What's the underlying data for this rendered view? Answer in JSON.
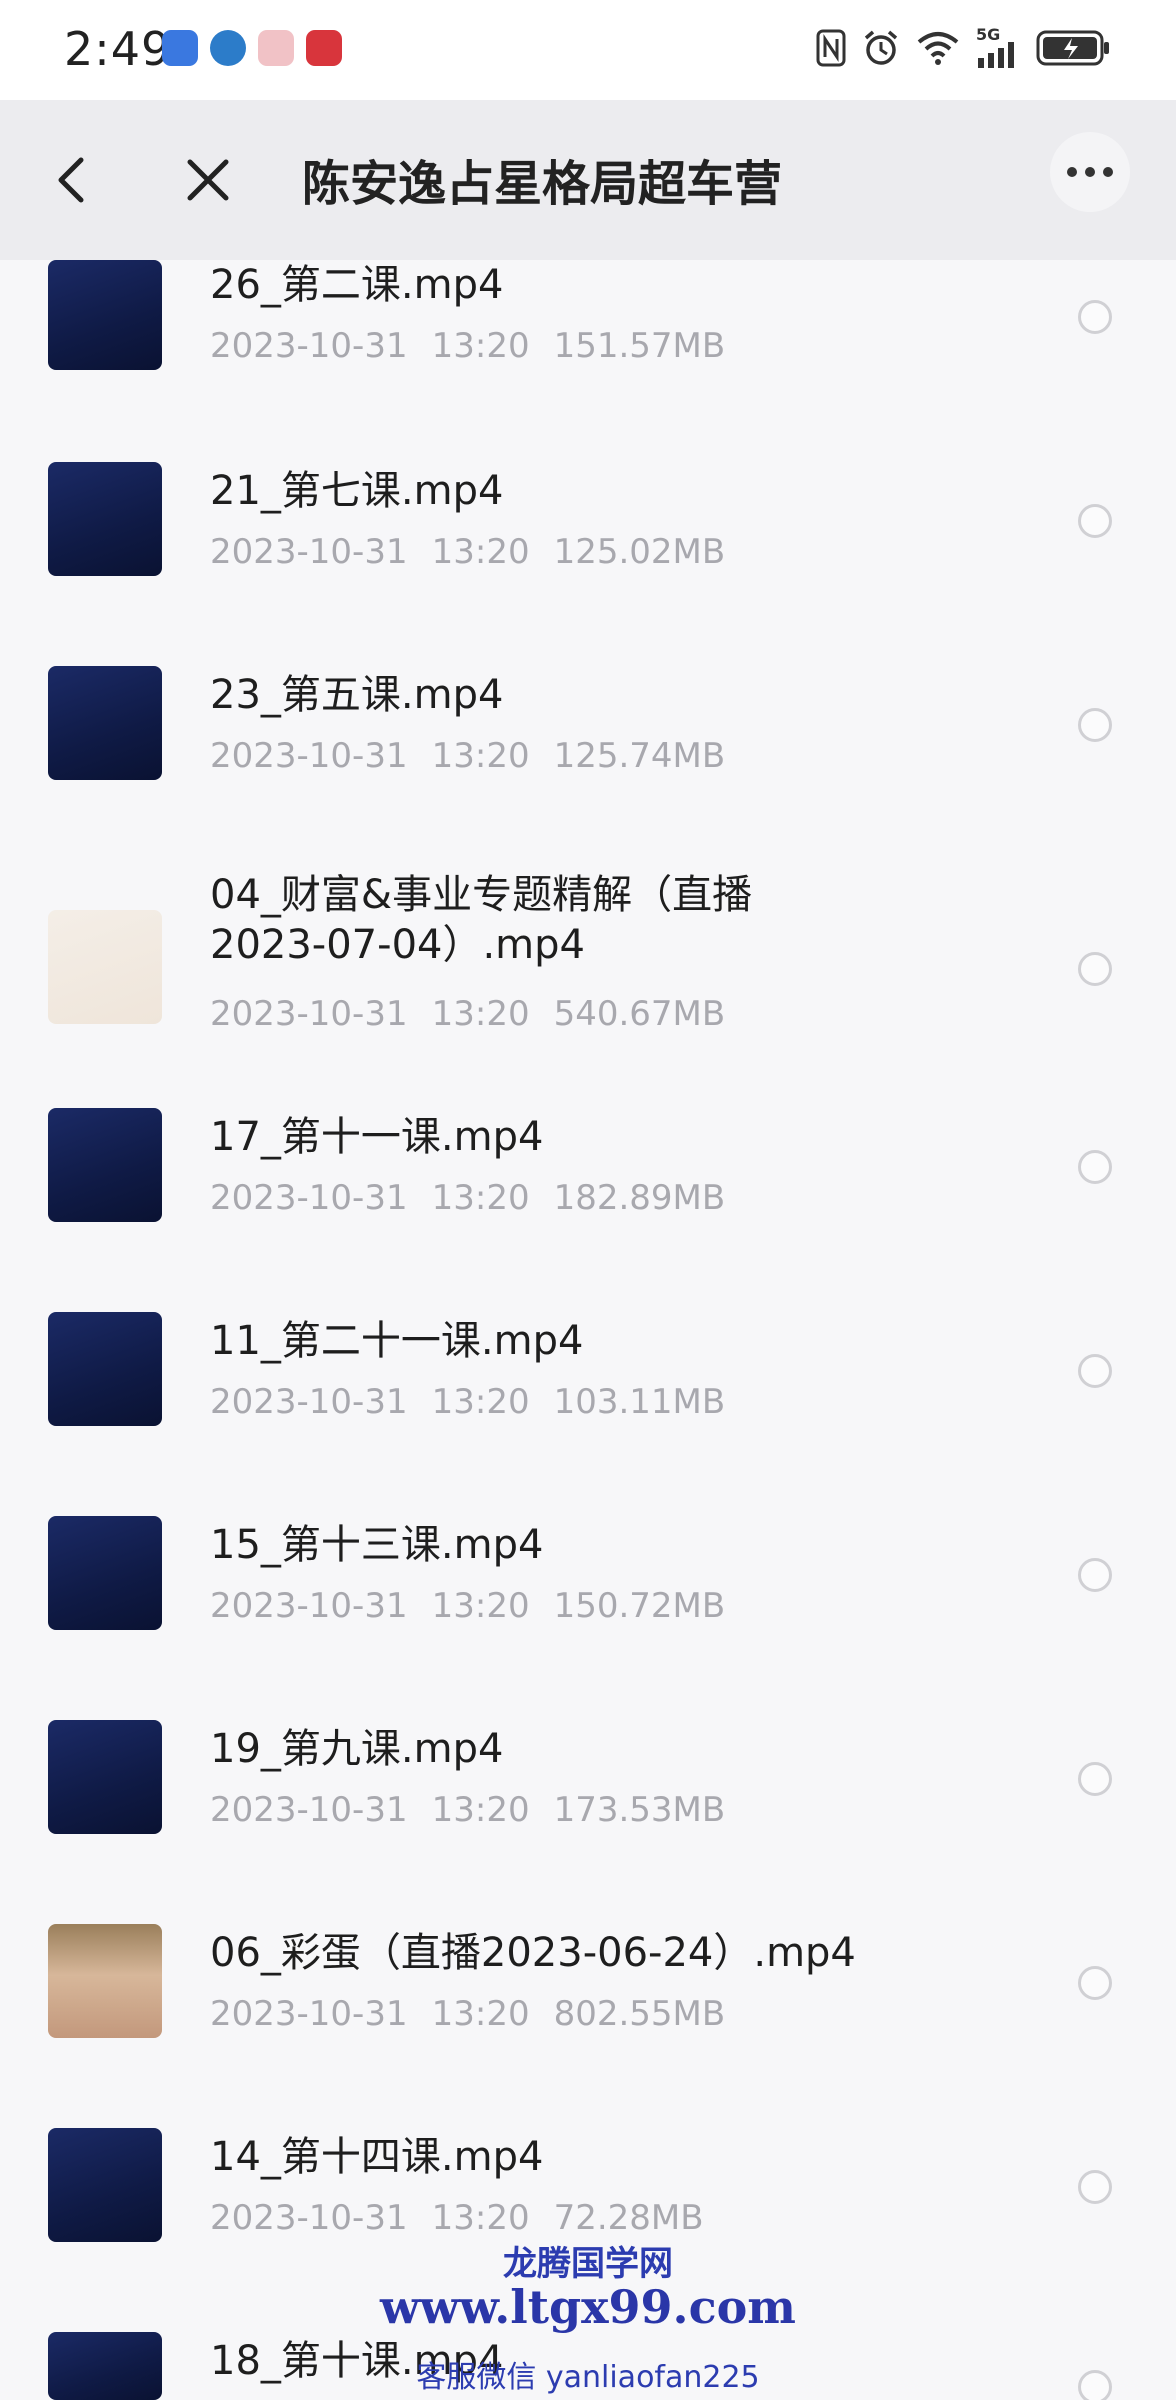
{
  "status_bar": {
    "time": "2:49",
    "network": "5G",
    "app_icon_names": [
      "app-blue-icon",
      "app-weather-icon",
      "app-gift-icon",
      "app-shop-icon"
    ]
  },
  "header": {
    "title": "陈安逸占星格局超车营"
  },
  "files": [
    {
      "name": "26_第二课.mp4",
      "date": "2023-10-31",
      "time": "13:20",
      "size": "151.57MB",
      "thumb": "dark"
    },
    {
      "name": "21_第七课.mp4",
      "date": "2023-10-31",
      "time": "13:20",
      "size": "125.02MB",
      "thumb": "dark"
    },
    {
      "name": "23_第五课.mp4",
      "date": "2023-10-31",
      "time": "13:20",
      "size": "125.74MB",
      "thumb": "dark"
    },
    {
      "name": "04_财富&事业专题精解（直播",
      "name2": "2023-07-04）.mp4",
      "date": "2023-10-31",
      "time": "13:20",
      "size": "540.67MB",
      "thumb": "light"
    },
    {
      "name": "17_第十一课.mp4",
      "date": "2023-10-31",
      "time": "13:20",
      "size": "182.89MB",
      "thumb": "dark"
    },
    {
      "name": "11_第二十一课.mp4",
      "date": "2023-10-31",
      "time": "13:20",
      "size": "103.11MB",
      "thumb": "dark"
    },
    {
      "name": "15_第十三课.mp4",
      "date": "2023-10-31",
      "time": "13:20",
      "size": "150.72MB",
      "thumb": "dark"
    },
    {
      "name": "19_第九课.mp4",
      "date": "2023-10-31",
      "time": "13:20",
      "size": "173.53MB",
      "thumb": "dark"
    },
    {
      "name": "06_彩蛋（直播2023-06-24）.mp4",
      "date": "2023-10-31",
      "time": "13:20",
      "size": "802.55MB",
      "thumb": "photo"
    },
    {
      "name": "14_第十四课.mp4",
      "date": "2023-10-31",
      "time": "13:20",
      "size": "72.28MB",
      "thumb": "dark"
    },
    {
      "name": "18_第十课.mp4",
      "date": "",
      "time": "",
      "size": "",
      "thumb": "dark"
    }
  ],
  "watermark": {
    "line1": "龙腾国学网",
    "line2": "www.ltgx99.com",
    "line3": "客服微信 yanliaofan225"
  }
}
